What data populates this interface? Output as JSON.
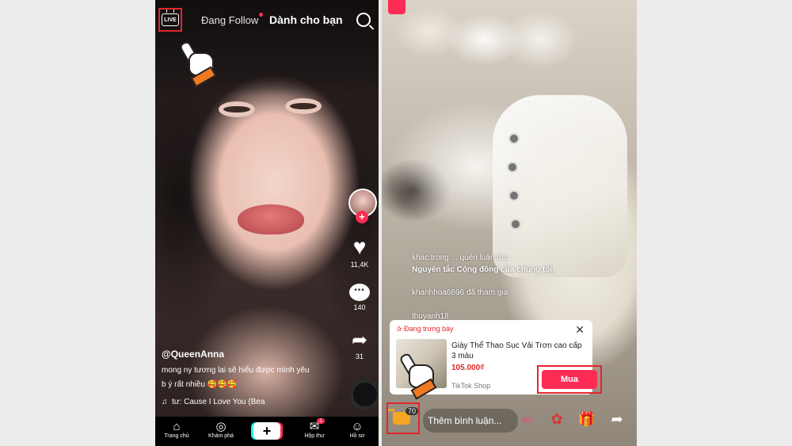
{
  "left": {
    "live_label": "LIVE",
    "tab_following": "Đang Follow",
    "tab_for_you": "Dành cho bạn",
    "likes": "11,4K",
    "comments": "140",
    "shares": "31",
    "username": "@QueenAnna",
    "desc_line1": "mong ny tương lai sẽ hiểu được mình yêu",
    "desc_line2": "b ý rất nhiều 🥰🥰🥰",
    "music": "tư: Cause I Love You (Bea",
    "nav": {
      "home": "Trang chủ",
      "discover": "Khám phá",
      "inbox": "Hộp thư",
      "inbox_badge": "1",
      "profile": "Hồ sơ"
    }
  },
  "right": {
    "chat": [
      {
        "text": "khác trong ... quên luận thu"
      },
      {
        "text": "Nguyên tắc Cộng đồng của chúng tôi."
      },
      {
        "text": "khanhhoa6696 đã tham gia"
      },
      {
        "text": "thuyanh18"
      }
    ],
    "product": {
      "status": "Đang trưng bày",
      "title": "Giày Thể Thao Sục Vải Trơn cao cấp 3 màu",
      "price": "105.000₫",
      "shop": "TikTok Shop",
      "buy_label": "Mua"
    },
    "cart_count": "70",
    "comment_placeholder": "Thêm bình luận..."
  }
}
